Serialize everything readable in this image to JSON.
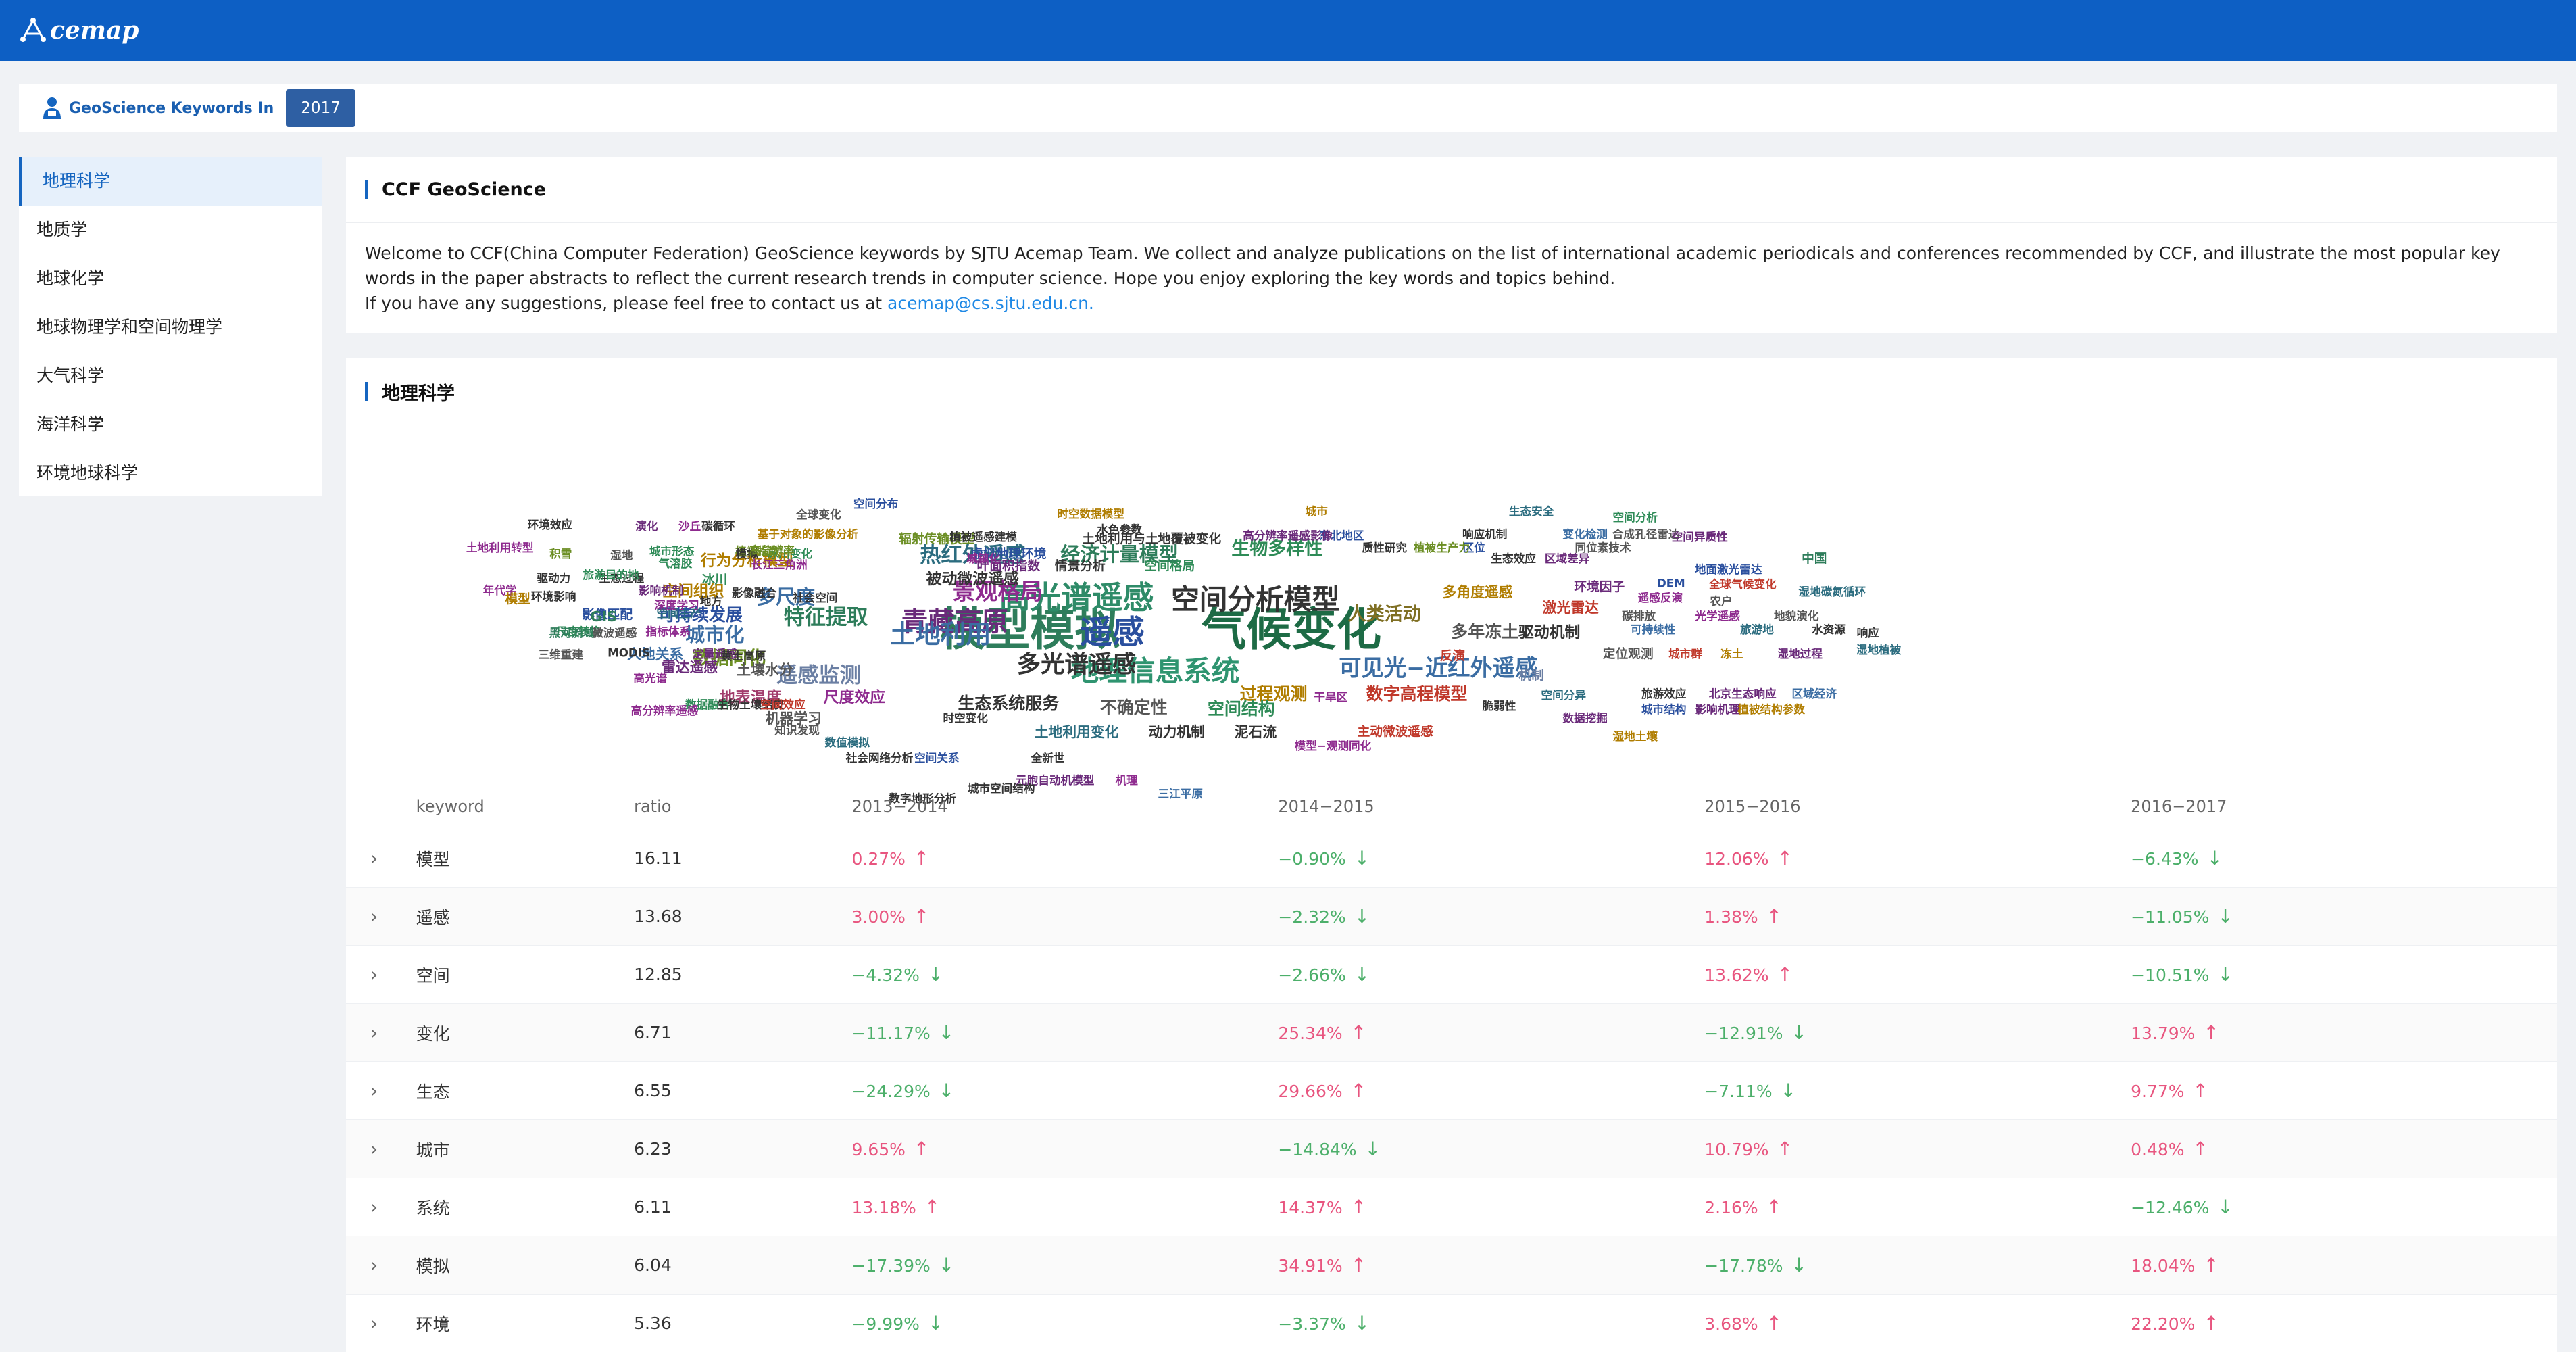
{
  "brand": {
    "name": "cemap",
    "logo_icon": "acemap-logo-icon"
  },
  "year_bar": {
    "label": "GeoScience Keywords In",
    "year": "2017"
  },
  "sidebar": {
    "items": [
      {
        "label": "地理科学",
        "active": true
      },
      {
        "label": "地质学",
        "active": false
      },
      {
        "label": "地球化学",
        "active": false
      },
      {
        "label": "地球物理学和空间物理学",
        "active": false
      },
      {
        "label": "大气科学",
        "active": false
      },
      {
        "label": "海洋科学",
        "active": false
      },
      {
        "label": "环境地球科学",
        "active": false
      }
    ]
  },
  "intro": {
    "title": "CCF GeoScience",
    "paragraph": "Welcome to CCF(China Computer Federation) GeoScience keywords by SJTU Acemap Team. We collect and analyze publications on the list of international academic periodicals and conferences recommended by CCF, and illustrate the most popular key words in the paper abstracts to reflect the current research trends in computer science. Hope you enjoy exploring the key words and topics behind.",
    "contact_prefix": "If you have any suggestions, please feel free to contact us at ",
    "contact_email": "acemap@cs.sjtu.edu.cn."
  },
  "main": {
    "title": "地理科学"
  },
  "wordcloud": [
    {
      "t": "模型模拟",
      "c": "#2e7d5b",
      "s": 64
    },
    {
      "t": "气候变化",
      "c": "#1d6b45",
      "s": 64
    },
    {
      "t": "遥感",
      "c": "#2a4f9e",
      "s": 46
    },
    {
      "t": "高光谱遥感",
      "c": "#2e8b68",
      "s": 44
    },
    {
      "t": "空间分析模型",
      "c": "#333",
      "s": 40
    },
    {
      "t": "地理信息系统",
      "c": "#2f9470",
      "s": 40
    },
    {
      "t": "青藏高原",
      "c": "#6a2a7a",
      "s": 38
    },
    {
      "t": "土地利用",
      "c": "#3b6da3",
      "s": 36
    },
    {
      "t": "可见光−近红外遥感",
      "c": "#3b6da3",
      "s": 32
    },
    {
      "t": "多光谱遥感",
      "c": "#333",
      "s": 34
    },
    {
      "t": "景观格局",
      "c": "#8e2a8e",
      "s": 32
    },
    {
      "t": "特征提取",
      "c": "#2e7d5b",
      "s": 30
    },
    {
      "t": "多尺度",
      "c": "#3b6da3",
      "s": 28
    },
    {
      "t": "热红外遥感",
      "c": "#2b6c7f",
      "s": 30
    },
    {
      "t": "经济计量模型",
      "c": "#2e7d5b",
      "s": 28
    },
    {
      "t": "遥感监测",
      "c": "#6b7fa3",
      "s": 30
    },
    {
      "t": "城市化",
      "c": "#3b6da3",
      "s": 28
    },
    {
      "t": "数据同化",
      "c": "#6b8e23",
      "s": 26
    },
    {
      "t": "人类活动",
      "c": "#7f6f23",
      "s": 26
    },
    {
      "t": "多年冻土",
      "c": "#555",
      "s": 24
    },
    {
      "t": "生物多样性",
      "c": "#2e8b57",
      "s": 26
    },
    {
      "t": "过程观测",
      "c": "#b07d00",
      "s": 24
    },
    {
      "t": "数字高程模型",
      "c": "#c0392b",
      "s": 24
    },
    {
      "t": "驱动机制",
      "c": "#333",
      "s": 22
    },
    {
      "t": "生态系统服务",
      "c": "#333",
      "s": 24
    },
    {
      "t": "不确定性",
      "c": "#555",
      "s": 24
    },
    {
      "t": "空间结构",
      "c": "#2e8b57",
      "s": 24
    },
    {
      "t": "尺度效应",
      "c": "#8e2a8e",
      "s": 22
    },
    {
      "t": "地表温度",
      "c": "#a23c6c",
      "s": 22
    },
    {
      "t": "可持续发展",
      "c": "#2a4f9e",
      "s": 24
    },
    {
      "t": "空间组织",
      "c": "#b07d00",
      "s": 22
    },
    {
      "t": "行为分析模型",
      "c": "#b07d00",
      "s": 22
    },
    {
      "t": "被动微波遥感",
      "c": "#333",
      "s": 22
    },
    {
      "t": "多角度遥感",
      "c": "#b07d00",
      "s": 20
    },
    {
      "t": "激光雷达",
      "c": "#c0392b",
      "s": 20
    },
    {
      "t": "环境因子",
      "c": "#6a2a7a",
      "s": 18
    },
    {
      "t": "雷达遥感",
      "c": "#6a2a7a",
      "s": 20
    },
    {
      "t": "土地利用变化",
      "c": "#2b6c7f",
      "s": 20
    },
    {
      "t": "动力机制",
      "c": "#333",
      "s": 20
    },
    {
      "t": "泥石流",
      "c": "#333",
      "s": 20
    },
    {
      "t": "主动微波遥感",
      "c": "#c0392b",
      "s": 18
    },
    {
      "t": "机器学习",
      "c": "#555",
      "s": 20
    },
    {
      "t": "土壤水分",
      "c": "#555",
      "s": 20
    },
    {
      "t": "人地关系",
      "c": "#3b6da3",
      "s": 20
    },
    {
      "t": "影像匹配",
      "c": "#2a4f9e",
      "s": 18
    },
    {
      "t": "冰川",
      "c": "#2e8b57",
      "s": 18
    },
    {
      "t": "辐射传输模型",
      "c": "#6b8e23",
      "s": 18
    },
    {
      "t": "空间格局",
      "c": "#2e8b57",
      "s": 18
    },
    {
      "t": "情景分析",
      "c": "#333",
      "s": 18
    },
    {
      "t": "土地利用与土地覆被变化",
      "c": "#333",
      "s": 18
    },
    {
      "t": "叶面积指数",
      "c": "#6a2a7a",
      "s": 18
    },
    {
      "t": "植被遥感建模",
      "c": "#333",
      "s": 16
    },
    {
      "t": "虚拟地理环境",
      "c": "#2a4f9e",
      "s": 18
    },
    {
      "t": "反演",
      "c": "#c0392b",
      "s": 18
    },
    {
      "t": "定位观测",
      "c": "#555",
      "s": 18
    },
    {
      "t": "城市群",
      "c": "#c0392b",
      "s": 16
    },
    {
      "t": "冻土",
      "c": "#b07d00",
      "s": 16
    },
    {
      "t": "湿地过程",
      "c": "#6a2a7a",
      "s": 16
    },
    {
      "t": "湿地植被",
      "c": "#2b6c7f",
      "s": 16
    },
    {
      "t": "机制",
      "c": "#6b7fa3",
      "s": 18
    },
    {
      "t": "空间分异",
      "c": "#2b6c7f",
      "s": 16
    },
    {
      "t": "脆弱性",
      "c": "#333",
      "s": 16
    },
    {
      "t": "数据挖掘",
      "c": "#6a2a7a",
      "s": 16
    },
    {
      "t": "湿地土壤",
      "c": "#b07d00",
      "s": 16
    },
    {
      "t": "城市结构",
      "c": "#2a4f9e",
      "s": 16
    },
    {
      "t": "影响机理",
      "c": "#6a2a7a",
      "s": 16
    },
    {
      "t": "植被结构参数",
      "c": "#b07d00",
      "s": 16
    },
    {
      "t": "旅游效应",
      "c": "#333",
      "s": 16
    },
    {
      "t": "北京生态响应",
      "c": "#6a2a7a",
      "s": 16
    },
    {
      "t": "区域经济",
      "c": "#3b6da3",
      "s": 16
    },
    {
      "t": "可持续性",
      "c": "#3b6da3",
      "s": 16
    },
    {
      "t": "旅游地",
      "c": "#2b6c7f",
      "s": 16
    },
    {
      "t": "水资源",
      "c": "#333",
      "s": 16
    },
    {
      "t": "响应",
      "c": "#333",
      "s": 16
    },
    {
      "t": "碳排放",
      "c": "#555",
      "s": 16
    },
    {
      "t": "光学遥感",
      "c": "#8e2a8e",
      "s": 16
    },
    {
      "t": "地貌演化",
      "c": "#555",
      "s": 16
    },
    {
      "t": "遥感反演",
      "c": "#8e2a8e",
      "s": 16
    },
    {
      "t": "农户",
      "c": "#555",
      "s": 16
    },
    {
      "t": "DEM",
      "c": "#2a4f9e",
      "s": 16
    },
    {
      "t": "全球气候变化",
      "c": "#c0392b",
      "s": 16
    },
    {
      "t": "湿地碳氮循环",
      "c": "#2b6c7f",
      "s": 16
    },
    {
      "t": "地面激光雷达",
      "c": "#2a4f9e",
      "s": 16
    },
    {
      "t": "中国",
      "c": "#2e7d5b",
      "s": 18
    },
    {
      "t": "生态效应",
      "c": "#333",
      "s": 16
    },
    {
      "t": "区域差异",
      "c": "#6a2a7a",
      "s": 16
    },
    {
      "t": "同位素技术",
      "c": "#555",
      "s": 16
    },
    {
      "t": "合成孔径雷达",
      "c": "#555",
      "s": 16
    },
    {
      "t": "区位",
      "c": "#2a4f9e",
      "s": 16
    },
    {
      "t": "空间异质性",
      "c": "#6a2a7a",
      "s": 16
    },
    {
      "t": "质性研究",
      "c": "#333",
      "s": 16
    },
    {
      "t": "植被生产力",
      "c": "#6b8e23",
      "s": 16
    },
    {
      "t": "响应机制",
      "c": "#333",
      "s": 16
    },
    {
      "t": "变化检测",
      "c": "#3b6da3",
      "s": 16
    },
    {
      "t": "空间分析",
      "c": "#2e8b57",
      "s": 16
    },
    {
      "t": "东北地区",
      "c": "#2a4f9e",
      "s": 16
    },
    {
      "t": "高分辨率遥感影像",
      "c": "#6a2a7a",
      "s": 16
    },
    {
      "t": "城市",
      "c": "#b07d00",
      "s": 16
    },
    {
      "t": "生态安全",
      "c": "#2b6c7f",
      "s": 16
    },
    {
      "t": "时空数据模型",
      "c": "#b07d00",
      "s": 16
    },
    {
      "t": "水色参数",
      "c": "#333",
      "s": 16
    },
    {
      "t": "空间分布",
      "c": "#2a4f9e",
      "s": 16
    },
    {
      "t": "全球变化",
      "c": "#555",
      "s": 16
    },
    {
      "t": "基于对象的影像分析",
      "c": "#b07d00",
      "s": 16
    },
    {
      "t": "沙丘",
      "c": "#8e2a8e",
      "s": 16
    },
    {
      "t": "冰川变化",
      "c": "#2e8b57",
      "s": 16
    },
    {
      "t": "植被指数",
      "c": "#6b8e23",
      "s": 16
    },
    {
      "t": "模拟",
      "c": "#333",
      "s": 16
    },
    {
      "t": "高分辨率",
      "c": "#6b8e23",
      "s": 16
    },
    {
      "t": "城市形态",
      "c": "#2e8b57",
      "s": 16
    },
    {
      "t": "演化",
      "c": "#6a2a7a",
      "s": 16
    },
    {
      "t": "气溶胶",
      "c": "#2e8b57",
      "s": 16
    },
    {
      "t": "环境效应",
      "c": "#333",
      "s": 16
    },
    {
      "t": "积雪",
      "c": "#6b8e23",
      "s": 16
    },
    {
      "t": "驱动力",
      "c": "#333",
      "s": 16
    },
    {
      "t": "碳循环",
      "c": "#333",
      "s": 16
    },
    {
      "t": "长江三角洲",
      "c": "#8e2a8e",
      "s": 16
    },
    {
      "t": "生态过程",
      "c": "#333",
      "s": 16
    },
    {
      "t": "地方",
      "c": "#333",
      "s": 16
    },
    {
      "t": "湿地",
      "c": "#555",
      "s": 16
    },
    {
      "t": "土地利用转型",
      "c": "#8e2a8e",
      "s": 16
    },
    {
      "t": "旅游目的地",
      "c": "#2e8b57",
      "s": 16
    },
    {
      "t": "空间生产",
      "c": "#2b6c7f",
      "s": 16
    },
    {
      "t": "环境影响",
      "c": "#333",
      "s": 16
    },
    {
      "t": "年代学",
      "c": "#8e2a8e",
      "s": 16
    },
    {
      "t": "影响机制",
      "c": "#6a2a7a",
      "s": 16
    },
    {
      "t": "模型",
      "c": "#b07d00",
      "s": 18
    },
    {
      "t": "GIS",
      "c": "#2e7d5b",
      "s": 20
    },
    {
      "t": "指标体系",
      "c": "#8e2a8e",
      "s": 16
    },
    {
      "t": "尺度转换",
      "c": "#2e8b57",
      "s": 16
    },
    {
      "t": "深度学习",
      "c": "#8e2a8e",
      "s": 16
    },
    {
      "t": "城镇化",
      "c": "#8e2a8e",
      "s": 16
    },
    {
      "t": "影像融合",
      "c": "#333",
      "s": 16
    },
    {
      "t": "微波遥感",
      "c": "#555",
      "s": 16
    },
    {
      "t": "黑河流域",
      "c": "#2e7d5b",
      "s": 16
    },
    {
      "t": "三维重建",
      "c": "#555",
      "s": 16
    },
    {
      "t": "MODIS",
      "c": "#333",
      "s": 16
    },
    {
      "t": "定量遥感",
      "c": "#6a2a7a",
      "s": 16
    },
    {
      "t": "高光谱",
      "c": "#8e2a8e",
      "s": 16
    },
    {
      "t": "黄土高原",
      "c": "#333",
      "s": 16
    },
    {
      "t": "数据融合",
      "c": "#2e8b57",
      "s": 16
    },
    {
      "t": "生物土壤结皮",
      "c": "#333",
      "s": 16
    },
    {
      "t": "高分辨率遥感",
      "c": "#8e2a8e",
      "s": 16
    },
    {
      "t": "空间效应",
      "c": "#c0392b",
      "s": 16
    },
    {
      "t": "数值模拟",
      "c": "#2b6c7f",
      "s": 16
    },
    {
      "t": "知识发现",
      "c": "#555",
      "s": 16
    },
    {
      "t": "社会空间",
      "c": "#333",
      "s": 16
    },
    {
      "t": "空间关系",
      "c": "#2a4f9e",
      "s": 16
    },
    {
      "t": "时空变化",
      "c": "#333",
      "s": 16
    },
    {
      "t": "全新世",
      "c": "#333",
      "s": 16
    },
    {
      "t": "社会网络分析",
      "c": "#333",
      "s": 16
    },
    {
      "t": "元胞自动机模型",
      "c": "#6a2a7a",
      "s": 16
    },
    {
      "t": "机理",
      "c": "#8e2a8e",
      "s": 16
    },
    {
      "t": "城市空间结构",
      "c": "#333",
      "s": 16
    },
    {
      "t": "数字地形分析",
      "c": "#333",
      "s": 16
    },
    {
      "t": "三江平原",
      "c": "#3b6da3",
      "s": 16
    },
    {
      "t": "干旱区",
      "c": "#8e2a8e",
      "s": 16
    },
    {
      "t": "模型−观测同化",
      "c": "#8e2a8e",
      "s": 16
    }
  ],
  "table": {
    "headers": [
      "keyword",
      "ratio",
      "2013−2014",
      "2014−2015",
      "2015−2016",
      "2016−2017"
    ],
    "expand_icon": "chevron-right-icon",
    "rows": [
      {
        "keyword": "模型",
        "ratio": "16.11",
        "y": [
          [
            "0.27%",
            "up"
          ],
          [
            "−0.90%",
            "down"
          ],
          [
            "12.06%",
            "up"
          ],
          [
            "−6.43%",
            "down"
          ]
        ]
      },
      {
        "keyword": "遥感",
        "ratio": "13.68",
        "y": [
          [
            "3.00%",
            "up"
          ],
          [
            "−2.32%",
            "down"
          ],
          [
            "1.38%",
            "up"
          ],
          [
            "−11.05%",
            "down"
          ]
        ]
      },
      {
        "keyword": "空间",
        "ratio": "12.85",
        "y": [
          [
            "−4.32%",
            "down"
          ],
          [
            "−2.66%",
            "down"
          ],
          [
            "13.62%",
            "up"
          ],
          [
            "−10.51%",
            "down"
          ]
        ]
      },
      {
        "keyword": "变化",
        "ratio": "6.71",
        "y": [
          [
            "−11.17%",
            "down"
          ],
          [
            "25.34%",
            "up"
          ],
          [
            "−12.91%",
            "down"
          ],
          [
            "13.79%",
            "up"
          ]
        ]
      },
      {
        "keyword": "生态",
        "ratio": "6.55",
        "y": [
          [
            "−24.29%",
            "down"
          ],
          [
            "29.66%",
            "up"
          ],
          [
            "−7.11%",
            "down"
          ],
          [
            "9.77%",
            "up"
          ]
        ]
      },
      {
        "keyword": "城市",
        "ratio": "6.23",
        "y": [
          [
            "9.65%",
            "up"
          ],
          [
            "−14.84%",
            "down"
          ],
          [
            "10.79%",
            "up"
          ],
          [
            "0.48%",
            "up"
          ]
        ]
      },
      {
        "keyword": "系统",
        "ratio": "6.11",
        "y": [
          [
            "13.18%",
            "up"
          ],
          [
            "14.37%",
            "up"
          ],
          [
            "2.16%",
            "up"
          ],
          [
            "−12.46%",
            "down"
          ]
        ]
      },
      {
        "keyword": "模拟",
        "ratio": "6.04",
        "y": [
          [
            "−17.39%",
            "down"
          ],
          [
            "34.91%",
            "up"
          ],
          [
            "−17.78%",
            "down"
          ],
          [
            "18.04%",
            "up"
          ]
        ]
      },
      {
        "keyword": "环境",
        "ratio": "5.36",
        "y": [
          [
            "−9.99%",
            "down"
          ],
          [
            "−3.37%",
            "down"
          ],
          [
            "3.68%",
            "up"
          ],
          [
            "22.20%",
            "up"
          ]
        ]
      }
    ]
  }
}
